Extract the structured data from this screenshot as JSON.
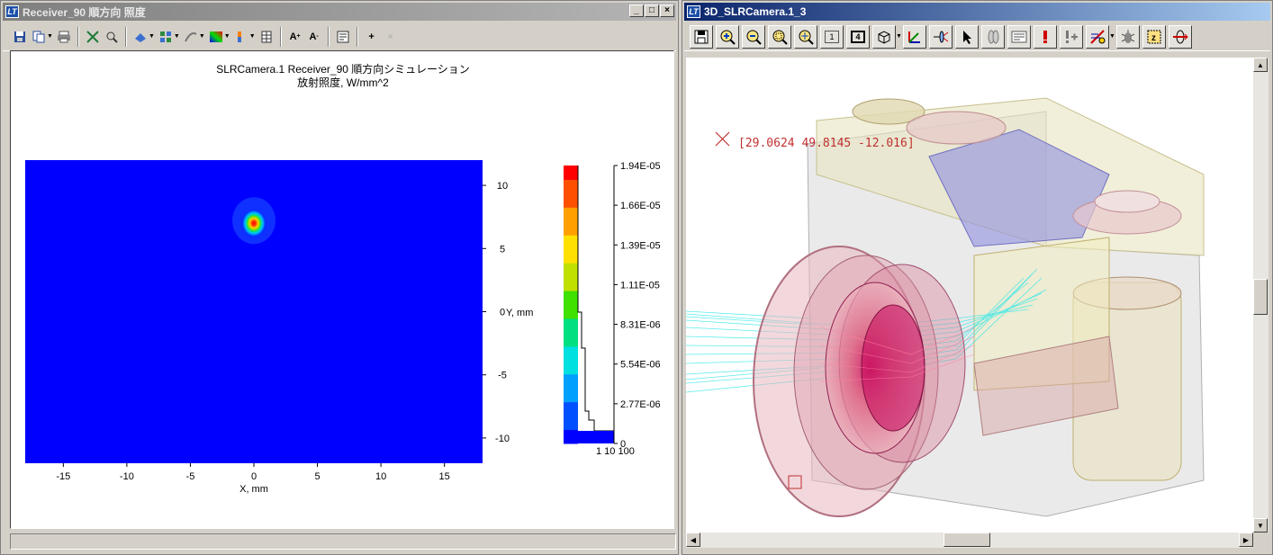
{
  "left_window": {
    "title": "Receiver_90 順方向 照度",
    "app_icon": "LT",
    "plot": {
      "title_line1": "SLRCamera.1 Receiver_90 順方向シミュレーション",
      "title_line2": "放射照度, W/mm^2",
      "x_label": "X, mm",
      "y_label": "Y, mm",
      "x_ticks": [
        "-15",
        "-10",
        "-5",
        "0",
        "5",
        "10",
        "15"
      ],
      "y_ticks": [
        "10",
        "5",
        "0",
        "-5",
        "-10"
      ],
      "colorbar_labels": [
        "1.94E-05",
        "1.66E-05",
        "1.39E-05",
        "1.11E-05",
        "8.31E-06",
        "5.54E-06",
        "2.77E-06",
        "0"
      ],
      "colorbar_sub": "1 10 100"
    }
  },
  "right_window": {
    "title": "3D_SLRCamera.1_3",
    "app_icon": "LT",
    "coord_readout": "[29.0624 49.8145 -12.016]",
    "toolbar": {
      "btn_1": "1",
      "btn_4": "4"
    }
  },
  "chart_data": {
    "type": "heatmap",
    "title": "SLRCamera.1 Receiver_90 順方向シミュレーション",
    "subtitle": "放射照度, W/mm^2",
    "xlabel": "X, mm",
    "ylabel": "Y, mm",
    "xlim": [
      -18,
      18
    ],
    "ylim": [
      -12,
      12
    ],
    "x_ticks": [
      -15,
      -10,
      -5,
      0,
      5,
      10,
      15
    ],
    "y_ticks": [
      10,
      5,
      0,
      -5,
      -10
    ],
    "zlim": [
      0,
      1.94e-05
    ],
    "background_value": 0,
    "hotspot": {
      "x": 0,
      "y": 7,
      "peak": 1.94e-05
    },
    "colorbar_ticks": [
      1.94e-05,
      1.66e-05,
      1.39e-05,
      1.11e-05,
      8.31e-06,
      5.54e-06,
      2.77e-06,
      0
    ],
    "colormap": [
      "#0000ff",
      "#0050ff",
      "#00a0ff",
      "#00e0e0",
      "#00e080",
      "#40e000",
      "#c0e000",
      "#ffe000",
      "#ffa000",
      "#ff5000",
      "#ff0000"
    ]
  }
}
